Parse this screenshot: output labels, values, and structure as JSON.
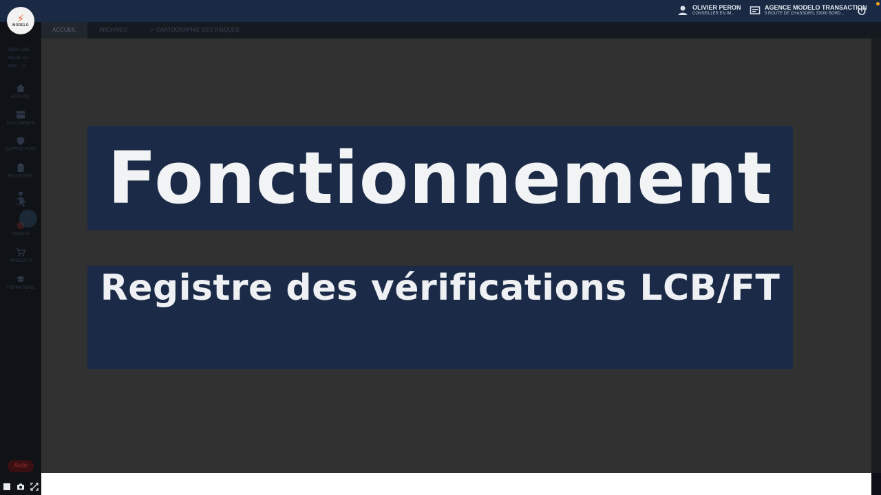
{
  "app": {
    "logo_text": "MODELO"
  },
  "header": {
    "user": {
      "name": "OLIVIER PERON",
      "role": "CONSEILLER EN IM..."
    },
    "agency": {
      "name": "AGENCE MODELO TRANSACTION",
      "address": "5 ROUTE DE CHASSORS, 33000 BORD..."
    },
    "power_icon": "power-icon"
  },
  "sidebar": {
    "stats": [
      {
        "label": "SIGN",
        "value": "1235"
      },
      {
        "label": "RECO",
        "value": "57"
      },
      {
        "label": "ERP",
        "value": "11"
      }
    ],
    "items": [
      {
        "label": "ACCUEIL",
        "icon": "home-icon"
      },
      {
        "label": "DOCUMENTS",
        "icon": "documents-icon"
      },
      {
        "label": "COFFRE-FORT",
        "icon": "shield-icon"
      },
      {
        "label": "REGISTRES",
        "icon": "clipboard-icon"
      },
      {
        "label": "LCB",
        "icon": "user-secret-icon"
      },
      {
        "label": "COMPTE",
        "icon": "account-icon"
      },
      {
        "label": "PRODUITS",
        "icon": "cart-icon"
      },
      {
        "label": "FORMATIONS",
        "icon": "graduation-cap-icon"
      }
    ],
    "help_label": "Aide"
  },
  "tabs": [
    {
      "label": "ACCUEIL",
      "active": true
    },
    {
      "label": "ARCHIVES",
      "active": false
    },
    {
      "label": "✓ CARTOGRAPHIE DES RISQUES",
      "active": false
    }
  ],
  "video": {
    "title": "Fonctionnement",
    "subtitle": "Registre des vérifications LCB/FT"
  },
  "colors": {
    "topbar": "#1b2a44",
    "banner": "#1b2b47",
    "accent_orange": "#e8602c"
  }
}
